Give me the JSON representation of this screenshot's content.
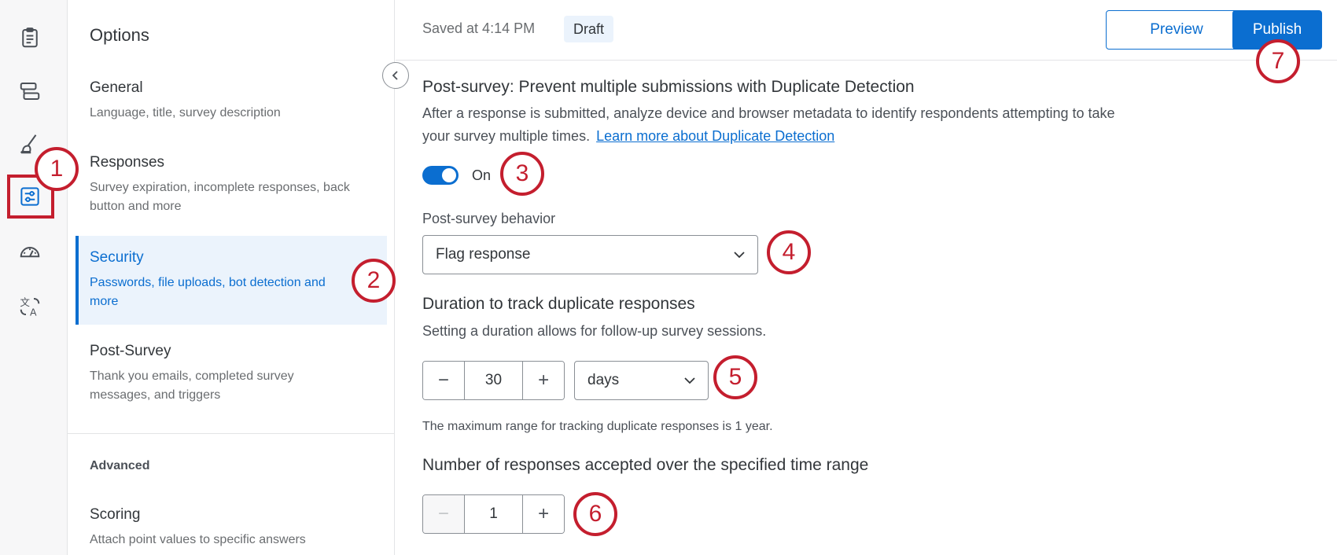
{
  "rail": {
    "icons": [
      "survey-icon",
      "workflow-icon",
      "look-and-feel-icon",
      "survey-options-icon",
      "dashboard-icon",
      "translate-icon"
    ]
  },
  "options": {
    "title": "Options",
    "items": [
      {
        "label": "General",
        "desc": "Language, title, survey description"
      },
      {
        "label": "Responses",
        "desc": "Survey expiration, incomplete responses, back button and more"
      },
      {
        "label": "Security",
        "desc": "Passwords, file uploads, bot detection and more"
      },
      {
        "label": "Post-Survey",
        "desc": "Thank you emails, completed survey messages, and triggers"
      }
    ],
    "advanced_label": "Advanced",
    "advanced_items": [
      {
        "label": "Scoring",
        "desc": "Attach point values to specific answers"
      }
    ]
  },
  "header": {
    "saved_text": "Saved at 4:14 PM",
    "status_badge": "Draft",
    "preview_label": "Preview",
    "publish_label": "Publish"
  },
  "content": {
    "title": "Post-survey: Prevent multiple submissions with Duplicate Detection",
    "desc_line1": "After a response is submitted, analyze device and browser metadata to identify respondents attempting to take",
    "desc_line2": "your survey multiple times.",
    "learn_more_link": "Learn more about Duplicate Detection",
    "toggle_label": "On",
    "behavior_label": "Post-survey behavior",
    "behavior_value": "Flag response",
    "duration_title": "Duration to track duplicate responses",
    "duration_desc": "Setting a duration allows for follow-up survey sessions.",
    "duration_value": "30",
    "duration_unit": "days",
    "duration_hint": "The maximum range for tracking duplicate responses is 1 year.",
    "count_title": "Number of responses accepted over the specified time range",
    "count_value": "1",
    "minus": "−",
    "plus": "+"
  },
  "callouts": [
    "1",
    "2",
    "3",
    "4",
    "5",
    "6",
    "7"
  ],
  "colors": {
    "accent": "#0b6ed0",
    "callout": "#c41e2e"
  }
}
